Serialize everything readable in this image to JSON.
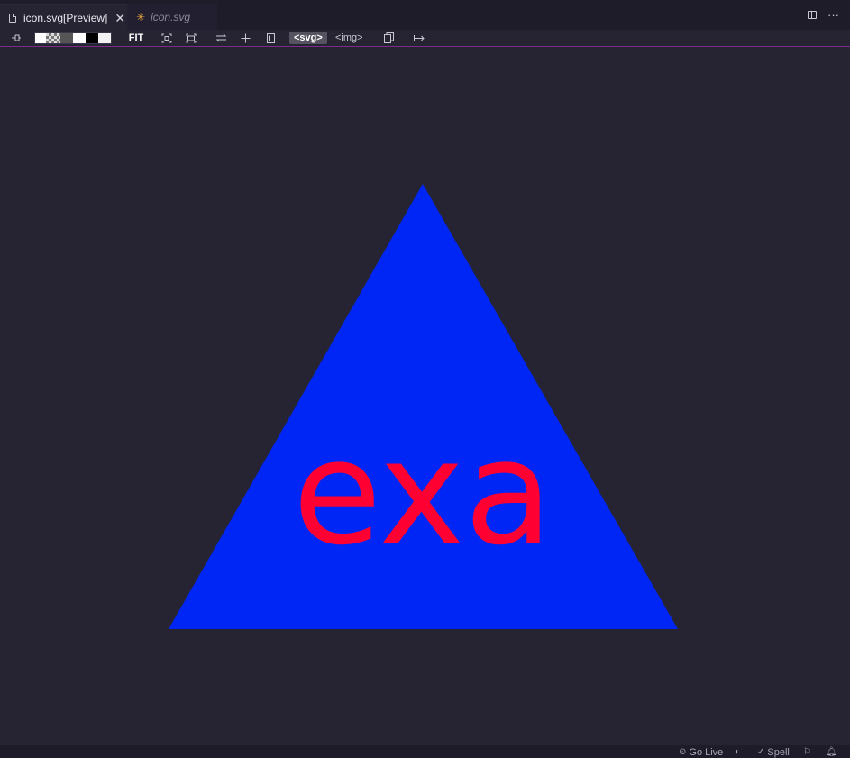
{
  "tabs": [
    {
      "label": "icon.svg[Preview]",
      "active": true,
      "icon": "file-icon"
    },
    {
      "label": "icon.svg",
      "active": false,
      "icon": "asterisk-icon"
    }
  ],
  "toolbar": {
    "fit_label": "FIT",
    "svg_label": "<svg>",
    "img_label": "<img>",
    "background_swatches": [
      "#ffffff",
      "checker",
      "#555555",
      "#ffffff",
      "#000000",
      "#f2f2f2"
    ]
  },
  "preview": {
    "triangle_color": "#0026f5",
    "text": "exa",
    "text_color": "#ff0033",
    "background": "#262433"
  },
  "statusbar": {
    "go_live": "Go Live",
    "spell": "Spell"
  },
  "colors": {
    "editor_background": "#262433",
    "tab_bar_background": "#1e1c29",
    "toolbar_border": "#7d2a8a"
  }
}
